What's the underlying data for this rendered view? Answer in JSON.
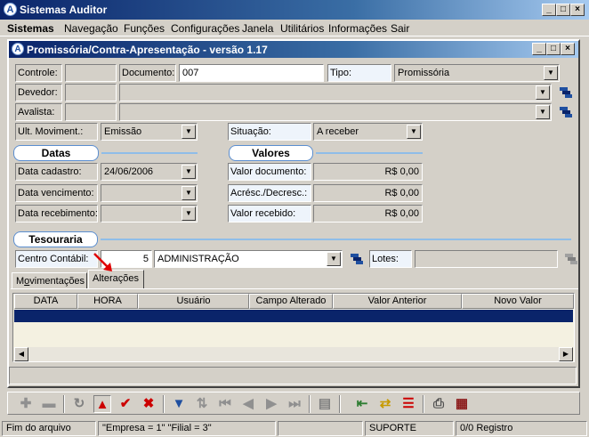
{
  "app": {
    "title": "Sistemas Auditor",
    "icon": "A"
  },
  "menu": [
    "Sistemas",
    "Navegação",
    "Funções",
    "Configurações",
    "Janela",
    "Utilitários",
    "Informações",
    "Sair"
  ],
  "window": {
    "title": "Promissória/Contra-Apresentação - versão 1.17",
    "icon": "A"
  },
  "form": {
    "controle_label": "Controle:",
    "controle_value": "",
    "documento_label": "Documento:",
    "documento_value": "007",
    "tipo_label": "Tipo:",
    "tipo_value": "Promissória",
    "devedor_label": "Devedor:",
    "devedor_code": "",
    "devedor_name": "",
    "avalista_label": "Avalista:",
    "avalista_code": "",
    "avalista_name": "",
    "ult_mov_label": "Ult. Moviment.:",
    "ult_mov_value": "Emissão",
    "situacao_label": "Situação:",
    "situacao_value": "A receber"
  },
  "datas": {
    "title": "Datas",
    "cadastro_label": "Data cadastro:",
    "cadastro_value": "24/06/2006",
    "vencimento_label": "Data vencimento:",
    "vencimento_value": "",
    "recebimento_label": "Data recebimento:",
    "recebimento_value": ""
  },
  "valores": {
    "title": "Valores",
    "documento_label": "Valor documento:",
    "documento_value": "R$ 0,00",
    "acresc_label": "Acrésc./Decresc.:",
    "acresc_value": "R$ 0,00",
    "recebido_label": "Valor recebido:",
    "recebido_value": "R$ 0,00"
  },
  "tesouraria": {
    "title": "Tesouraria",
    "centro_label": "Centro Contábil:",
    "centro_code": "5",
    "centro_name": "ADMINISTRAÇÃO",
    "lotes_label": "Lotes:",
    "lotes_value": ""
  },
  "tabs": [
    {
      "label": "Movimentações",
      "active": false
    },
    {
      "label": "Alterações",
      "active": true
    }
  ],
  "grid": {
    "columns": [
      "DATA",
      "HORA",
      "Usuário",
      "Campo Alterado",
      "Valor Anterior",
      "Novo Valor"
    ],
    "rows": []
  },
  "toolbar": {
    "icons": [
      "add-icon",
      "remove-icon",
      "refresh-icon",
      "warning-triangle-icon",
      "confirm-check-icon",
      "cancel-x-icon",
      "filter-funnel-icon",
      "sort-arrows-icon",
      "first-record-icon",
      "previous-record-icon",
      "next-record-icon",
      "last-record-icon",
      "copy-document-icon",
      "import-list-icon",
      "export-list-icon",
      "report-list-icon",
      "print-icon",
      "calendar-report-icon"
    ],
    "accent_red": "#cc0000",
    "accent_blue": "#1f4fa0"
  },
  "status": {
    "msg": "Fim do arquivo",
    "empresa": "\"Empresa = 1\"   \"Filial = 3\"",
    "blank": "",
    "user": "SUPORTE",
    "registro": "0/0 Registro"
  }
}
